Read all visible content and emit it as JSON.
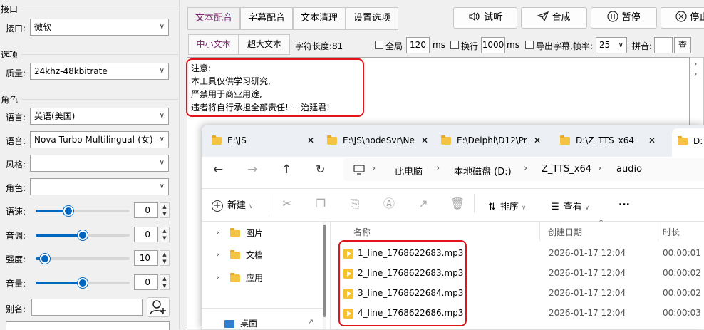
{
  "left_panel": {
    "group_interface": "接口",
    "interface_label": "接口:",
    "interface_value": "微软",
    "group_options": "选项",
    "quality_label": "质量:",
    "quality_value": "24khz-48kbitrate",
    "group_role": "角色",
    "language_label": "语言:",
    "language_value": "英语(美国)",
    "voice_label": "语音:",
    "voice_value": "Nova Turbo Multilingual-(女)-",
    "style_label": "风格:",
    "style_value": "",
    "role_label": "角色:",
    "role_value": "",
    "speed_label": "语速:",
    "speed_value": "0",
    "speed_level": 0.35,
    "pitch_label": "音调:",
    "pitch_value": "0",
    "pitch_level": 0.5,
    "intensity_label": "强度:",
    "intensity_value": "10",
    "intensity_level": 0.1,
    "volume_label": "音量:",
    "volume_value": "0",
    "volume_level": 0.5,
    "alias_label": "别名:",
    "alias_value": ""
  },
  "top_tabs": [
    "文本配音",
    "字幕配音",
    "文本清理",
    "设置选项"
  ],
  "actions": {
    "listen": "试听",
    "synthesize": "合成",
    "pause": "暂停",
    "stop": "停止"
  },
  "subbar": {
    "tab_small": "中小文本",
    "tab_large": "超大文本",
    "char_length": "字符长度:81",
    "global_label": "全局",
    "global_value": "120",
    "global_unit": "ms",
    "newline_label": "换行",
    "newline_value": "1000",
    "newline_unit": "ms",
    "export_label": "导出字幕,帧率:",
    "fps_value": "25",
    "pinyin_label": "拼音:",
    "pinyin_value": "",
    "lookup_button": "查"
  },
  "editor": {
    "lines": [
      "注意:",
      "本工具仅供学习研究,",
      "严禁用于商业用途,",
      "违者将自行承担全部责任!----治廷君!"
    ]
  },
  "explorer": {
    "tabs": [
      "E:\\JS",
      "E:\\JS\\nodeSvr\\Ne",
      "E:\\Delphi\\D12\\Pr",
      "D:\\Z_TTS_x64",
      "D:"
    ],
    "breadcrumb": [
      "此电脑",
      "本地磁盘 (D:)",
      "Z_TTS_x64",
      "audio"
    ],
    "toolbar": {
      "new": "新建",
      "sort": "排序",
      "view": "查看",
      "more": "..."
    },
    "nav": [
      "图片",
      "文档",
      "应用",
      "桌面"
    ],
    "columns": [
      "名称",
      "创建日期",
      "时长"
    ],
    "files": [
      {
        "name": "1_line_1768622683.mp3",
        "date": "2026-01-17 12:04",
        "duration": "00:00:01"
      },
      {
        "name": "2_line_1768622683.mp3",
        "date": "2026-01-17 12:04",
        "duration": "00:00:02"
      },
      {
        "name": "3_line_1768622684.mp3",
        "date": "2026-01-17 12:04",
        "duration": "00:00:02"
      },
      {
        "name": "4_line_1768622686.mp3",
        "date": "2026-01-17 12:04",
        "duration": "00:00:03"
      }
    ]
  },
  "colors": {
    "accent": "#0067c0",
    "highlight": "#e0141a",
    "tab_active_text": "#7a1f6e"
  }
}
